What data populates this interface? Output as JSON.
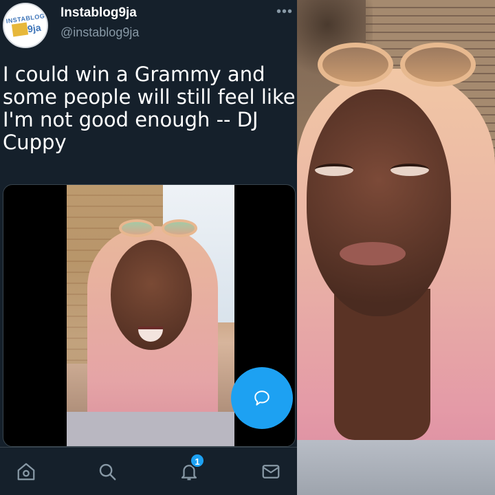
{
  "tweet": {
    "display_name": "Instablog9ja",
    "handle": "@instablog9ja",
    "more_icon": "more-horizontal-icon",
    "text_lines": [
      "I could win a Grammy and",
      "some people will still feel like",
      "I'm not good enough -- DJ",
      "Cuppy"
    ],
    "avatar_logo": {
      "top": "INSTABLOG",
      "num": "9ja"
    }
  },
  "fab": {
    "icon": "compose-reply-icon",
    "color": "#1da1f2"
  },
  "bottom_nav": {
    "items": [
      {
        "name": "home",
        "icon": "home-icon"
      },
      {
        "name": "search",
        "icon": "search-icon"
      },
      {
        "name": "notifications",
        "icon": "bell-icon",
        "badge": "1"
      },
      {
        "name": "messages",
        "icon": "mail-icon"
      }
    ]
  },
  "colors": {
    "background": "#15202b",
    "accent": "#1da1f2",
    "secondary_text": "#8899a6",
    "border": "#38444d"
  }
}
